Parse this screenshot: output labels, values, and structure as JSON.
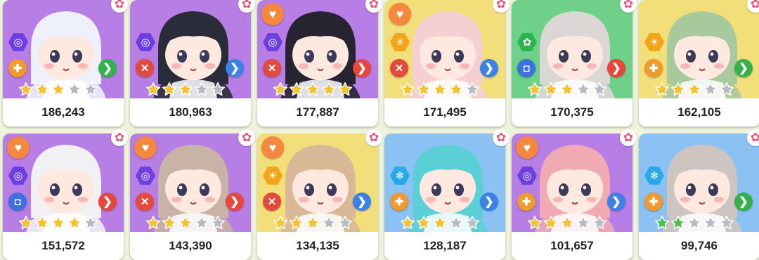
{
  "cards": [
    {
      "power": "186,243",
      "bg": "purple",
      "element": {
        "icon": "spiral-icon",
        "glyph": "◎",
        "color": "#6d3fe0"
      },
      "role": {
        "icon": "plus-icon",
        "glyph": "✚",
        "color": "orange"
      },
      "next": {
        "color": "green",
        "glyph": "❯"
      },
      "stars_gold": 3,
      "stars_total": 5,
      "heart": false,
      "hair": "#eef0fb"
    },
    {
      "power": "180,963",
      "bg": "purple",
      "element": {
        "icon": "spiral-icon",
        "glyph": "◎",
        "color": "#6d3fe0"
      },
      "role": {
        "icon": "swords-icon",
        "glyph": "✕",
        "color": "red"
      },
      "next": {
        "color": "blue",
        "glyph": "❯"
      },
      "stars_gold": 3,
      "stars_total": 5,
      "heart": false,
      "hair": "#2b2c3a"
    },
    {
      "power": "177,887",
      "bg": "purple",
      "element": {
        "icon": "spiral-icon",
        "glyph": "◎",
        "color": "#6d3fe0"
      },
      "role": {
        "icon": "swords-icon",
        "glyph": "✕",
        "color": "red"
      },
      "next": {
        "color": "red",
        "glyph": "❯"
      },
      "stars_gold": 5,
      "stars_total": 5,
      "heart": true,
      "hair": "#262430"
    },
    {
      "power": "171,495",
      "bg": "yellow",
      "element": {
        "icon": "sun-icon",
        "glyph": "☀",
        "color": "#f2a51a"
      },
      "role": {
        "icon": "swords-icon",
        "glyph": "✕",
        "color": "red"
      },
      "next": {
        "color": "blue",
        "glyph": "❯"
      },
      "stars_gold": 4,
      "stars_total": 5,
      "heart": true,
      "hair": "#f6cfd2"
    },
    {
      "power": "170,375",
      "bg": "green",
      "element": {
        "icon": "clover-icon",
        "glyph": "✿",
        "color": "#2fb34c"
      },
      "role": {
        "icon": "shield-icon",
        "glyph": "◘",
        "color": "blue"
      },
      "next": {
        "color": "red",
        "glyph": "❯"
      },
      "stars_gold": 3,
      "stars_total": 5,
      "heart": false,
      "hair": "#dad7d4"
    },
    {
      "power": "162,105",
      "bg": "yellow",
      "element": {
        "icon": "sun-icon",
        "glyph": "☀",
        "color": "#f2a51a"
      },
      "role": {
        "icon": "plus-icon",
        "glyph": "✚",
        "color": "orange"
      },
      "next": {
        "color": "green",
        "glyph": "❯"
      },
      "stars_gold": 3,
      "stars_total": 5,
      "heart": false,
      "hair": "#a8c99b"
    },
    {
      "power": "151,572",
      "bg": "purple",
      "element": {
        "icon": "spiral-icon",
        "glyph": "◎",
        "color": "#6d3fe0"
      },
      "role": {
        "icon": "shield-icon",
        "glyph": "◘",
        "color": "blue"
      },
      "next": {
        "color": "red",
        "glyph": "❯"
      },
      "stars_gold": 4,
      "stars_total": 5,
      "heart": true,
      "hair": "#f1f0f3"
    },
    {
      "power": "143,390",
      "bg": "purple",
      "element": {
        "icon": "spiral-icon",
        "glyph": "◎",
        "color": "#6d3fe0"
      },
      "role": {
        "icon": "swords-icon",
        "glyph": "✕",
        "color": "red"
      },
      "next": {
        "color": "red",
        "glyph": "❯"
      },
      "stars_gold": 3,
      "stars_total": 5,
      "heart": true,
      "hair": "#c8b3a6"
    },
    {
      "power": "134,135",
      "bg": "yellow",
      "element": {
        "icon": "sun-icon",
        "glyph": "☀",
        "color": "#f2a51a"
      },
      "role": {
        "icon": "swords-icon",
        "glyph": "✕",
        "color": "red"
      },
      "next": {
        "color": "blue",
        "glyph": "❯"
      },
      "stars_gold": 3,
      "stars_total": 5,
      "heart": true,
      "hair": "#d9b898"
    },
    {
      "power": "128,187",
      "bg": "blue",
      "element": {
        "icon": "snowflake-icon",
        "glyph": "❄",
        "color": "#2aa9e6"
      },
      "role": {
        "icon": "plus-icon",
        "glyph": "✚",
        "color": "orange"
      },
      "next": {
        "color": "blue",
        "glyph": "❯"
      },
      "stars_gold": 3,
      "stars_total": 5,
      "heart": false,
      "hair": "#5ad0d6"
    },
    {
      "power": "101,657",
      "bg": "purple",
      "element": {
        "icon": "spiral-icon",
        "glyph": "◎",
        "color": "#6d3fe0"
      },
      "role": {
        "icon": "plus-icon",
        "glyph": "✚",
        "color": "orange"
      },
      "next": {
        "color": "blue",
        "glyph": "❯"
      },
      "stars_gold": 3,
      "stars_total": 5,
      "heart": true,
      "hair": "#f0aab3"
    },
    {
      "power": "99,746",
      "bg": "blue",
      "element": {
        "icon": "snowflake-icon",
        "glyph": "❄",
        "color": "#2aa9e6"
      },
      "role": {
        "icon": "plus-icon",
        "glyph": "✚",
        "color": "orange"
      },
      "next": {
        "color": "green",
        "glyph": "❯"
      },
      "stars_gold": 2,
      "stars_total": 5,
      "star_color": "green",
      "heart": false,
      "hair": "#cfc5c0"
    }
  ],
  "colors": {
    "star_gold": "#f7c12a",
    "star_green": "#47c24e",
    "star_empty": "#b7bcc4",
    "page_bg": "#eef3dc"
  }
}
